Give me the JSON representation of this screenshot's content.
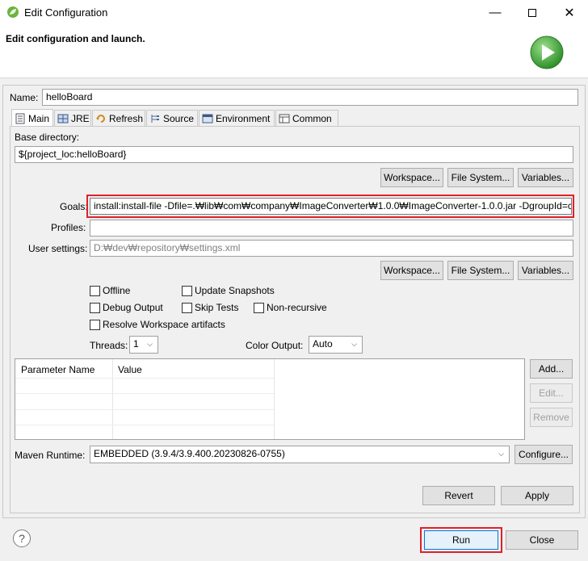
{
  "window": {
    "title": "Edit Configuration"
  },
  "banner": {
    "title": "Edit configuration and launch."
  },
  "name": {
    "label": "Name:",
    "value": "helloBoard"
  },
  "tabs": [
    {
      "label": "Main",
      "icon": "main-tab-icon"
    },
    {
      "label": "JRE",
      "icon": "jre-tab-icon"
    },
    {
      "label": "Refresh",
      "icon": "refresh-tab-icon"
    },
    {
      "label": "Source",
      "icon": "source-tab-icon"
    },
    {
      "label": "Environment",
      "icon": "environment-tab-icon"
    },
    {
      "label": "Common",
      "icon": "common-tab-icon"
    }
  ],
  "main": {
    "base_directory_label": "Base directory:",
    "base_directory_value": "${project_loc:helloBoard}",
    "workspace_button": "Workspace...",
    "filesystem_button": "File System...",
    "variables_button": "Variables...",
    "goals_label": "Goals:",
    "goals_value": "install:install-file -Dfile=.₩lib₩com₩company₩ImageConverter₩1.0.0₩ImageConverter-1.0.0.jar -DgroupId=c",
    "profiles_label": "Profiles:",
    "profiles_value": "",
    "user_settings_label": "User settings:",
    "user_settings_value": "D:₩dev₩repository₩settings.xml",
    "options": {
      "offline": "Offline",
      "update_snapshots": "Update Snapshots",
      "debug_output": "Debug Output",
      "skip_tests": "Skip Tests",
      "non_recursive": "Non-recursive",
      "resolve_workspace": "Resolve Workspace artifacts"
    },
    "threads_label": "Threads:",
    "threads_value": "1",
    "color_output_label": "Color Output:",
    "color_output_value": "Auto",
    "params_table": {
      "columns": [
        "Parameter Name",
        "Value"
      ]
    },
    "add_button": "Add...",
    "edit_button": "Edit...",
    "remove_button": "Remove",
    "maven_runtime_label": "Maven Runtime:",
    "maven_runtime_value": "EMBEDDED (3.9.4/3.9.400.20230826-0755)",
    "configure_button": "Configure..."
  },
  "footer": {
    "revert_button": "Revert",
    "apply_button": "Apply",
    "run_button": "Run",
    "close_button": "Close",
    "help_icon": "help-icon"
  },
  "colors": {
    "highlight_red": "#e0202a",
    "run_green": "#3fae3a"
  }
}
